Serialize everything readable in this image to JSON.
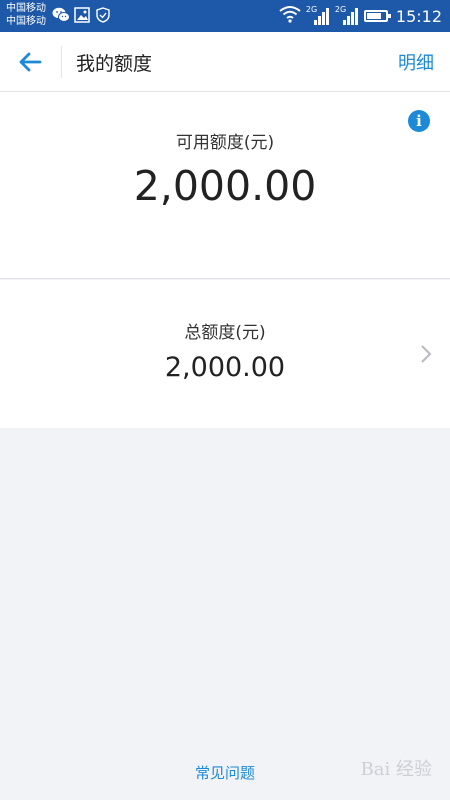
{
  "status_bar": {
    "carrier_1": "中国移动",
    "carrier_2": "中国移动",
    "network_1": "2G",
    "network_2": "2G",
    "time": "15:12",
    "battery_level": 0.75,
    "icons": [
      "wechat-icon",
      "image-icon",
      "shield-icon",
      "wifi-icon",
      "signal-icon",
      "signal-icon",
      "battery-icon"
    ]
  },
  "header": {
    "title": "我的额度",
    "detail_link": "明细",
    "back_icon": "arrow-left-icon",
    "accent_color": "#1d8ad8"
  },
  "available": {
    "label": "可用额度(元)",
    "amount": "2,000.00",
    "info_icon": "i"
  },
  "total": {
    "label": "总额度(元)",
    "amount": "2,000.00",
    "chevron_icon": "chevron-right-icon"
  },
  "footer": {
    "faq_link": "常见问题",
    "watermark": "Bai 经验"
  }
}
